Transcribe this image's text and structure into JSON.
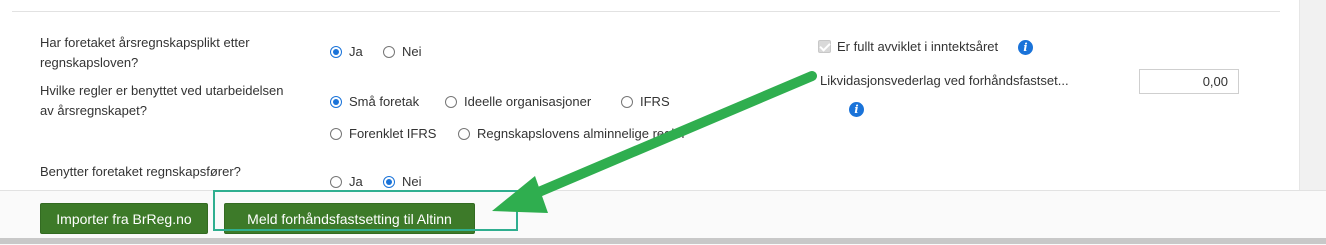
{
  "form": {
    "q1": {
      "label": "Har foretaket årsregnskapsplikt etter regnskapsloven?",
      "options": [
        {
          "label": "Ja",
          "selected": true
        },
        {
          "label": "Nei",
          "selected": false
        }
      ]
    },
    "q2": {
      "label": "Hvilke regler er benyttet ved utarbeidelsen av årsregnskapet?",
      "options": [
        {
          "label": "Små foretak",
          "selected": true
        },
        {
          "label": "Ideelle organisasjoner",
          "selected": false
        },
        {
          "label": "IFRS",
          "selected": false
        },
        {
          "label": "Forenklet IFRS",
          "selected": false
        },
        {
          "label": "Regnskapslovens alminnelige regler",
          "selected": false
        }
      ]
    },
    "q3": {
      "label": "Benytter foretaket regnskapsfører?",
      "options": [
        {
          "label": "Ja",
          "selected": false
        },
        {
          "label": "Nei",
          "selected": true
        }
      ]
    },
    "wound_up": {
      "label": "Er fullt avviklet i inntektsåret",
      "checked": true,
      "disabled": true
    },
    "liquidation": {
      "label": "Likvidasjonsvederlag ved forhåndsfastset...",
      "value": "0,00"
    }
  },
  "footer": {
    "import_button": "Importer fra BrReg.no",
    "report_button": "Meld forhåndsfastsetting til Altinn"
  },
  "colors": {
    "button_green": "#3d7a29",
    "radio_blue": "#1a73d9",
    "annotation_arrow": "#2fae4f",
    "highlight_box": "#2fae8f"
  },
  "icons": {
    "info": "info-icon"
  }
}
